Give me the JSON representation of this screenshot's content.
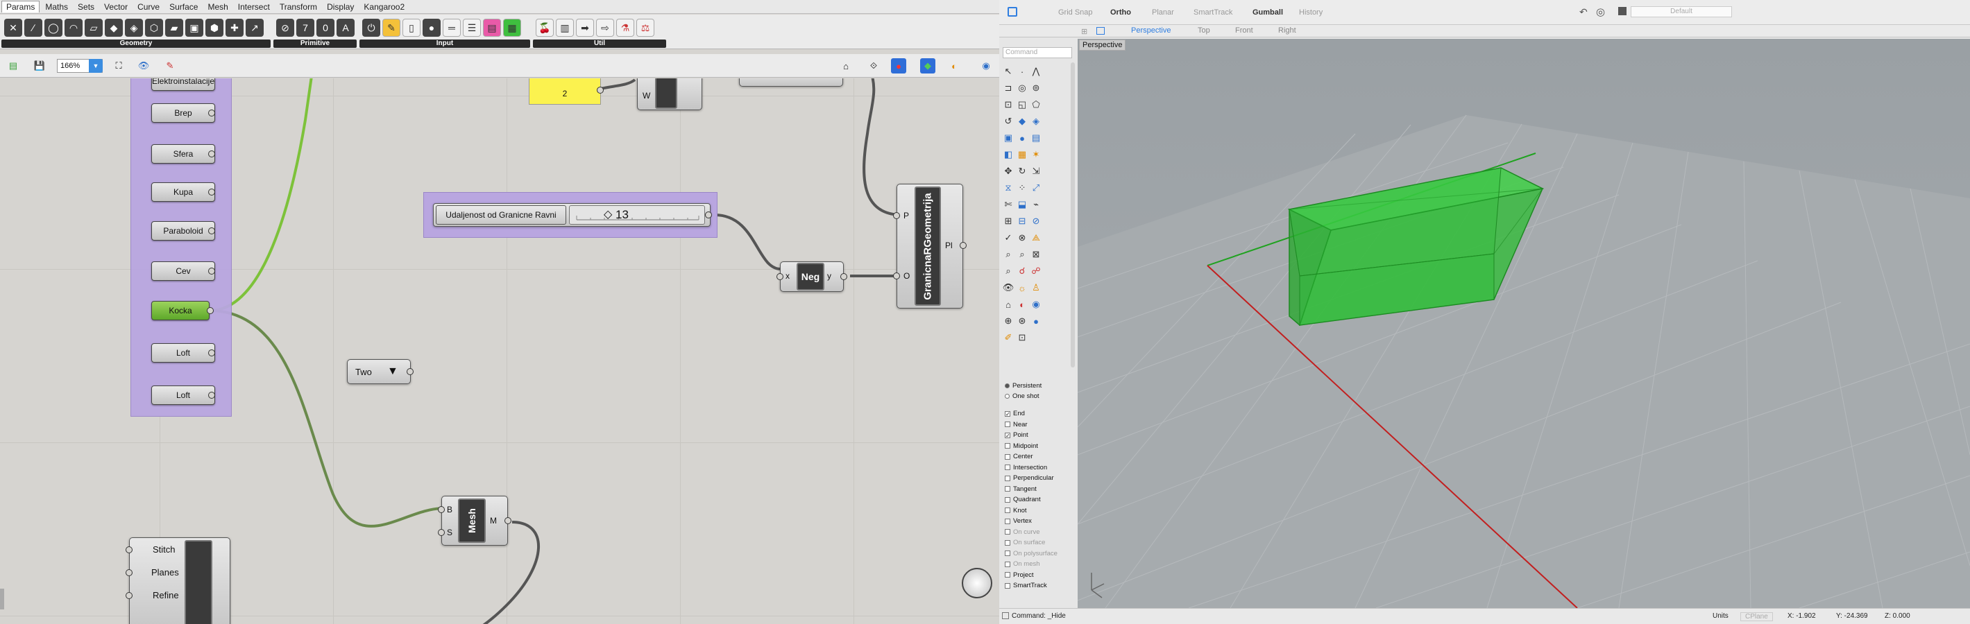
{
  "gh": {
    "tabs": [
      "Params",
      "Maths",
      "Sets",
      "Vector",
      "Curve",
      "Surface",
      "Mesh",
      "Intersect",
      "Transform",
      "Display",
      "Kangaroo2"
    ],
    "groups": [
      "Geometry",
      "Primitive",
      "Input",
      "Util"
    ],
    "zoom": "166%",
    "buttons": [
      "Brep",
      "Sfera",
      "Kupa",
      "Paraboloid",
      "Cev",
      "Kocka",
      "Loft",
      "Loft"
    ],
    "partial_button": "Elektroinstalacije",
    "panel_value": "2",
    "slider_label": "Udaljenost od Granicne Ravni",
    "slider_value": "13",
    "value_list": "Two",
    "neg": {
      "name": "Neg",
      "in": "x",
      "out": "y"
    },
    "granica": {
      "name": "GranicnaRGeometrija",
      "in1": "P",
      "in2": "O",
      "out": "Pl"
    },
    "mesh": {
      "name": "Mesh",
      "in1": "B",
      "in2": "S",
      "out": "M"
    },
    "w_comp_in": "W",
    "bottom_comp": {
      "inputs": [
        "Stitch",
        "Planes",
        "Refine"
      ]
    },
    "icon_colors": {
      "wire_green": "#7dc23a",
      "group": "#b9a6e0",
      "panel": "#fbf24f"
    }
  },
  "rhino": {
    "top": {
      "grid_snap": "Grid Snap",
      "ortho": "Ortho",
      "planar": "Planar",
      "smarttrack": "SmartTrack",
      "gumball": "Gumball",
      "history": "History",
      "layer": "Default"
    },
    "view_tabs": [
      "Perspective",
      "Top",
      "Front",
      "Right"
    ],
    "viewport_label": "Perspective",
    "command_placeholder": "Command",
    "osnap_mode": [
      {
        "label": "Persistent",
        "on": true
      },
      {
        "label": "One shot",
        "on": false
      }
    ],
    "osnaps": [
      {
        "label": "End",
        "checked": true,
        "enabled": true
      },
      {
        "label": "Near",
        "checked": false,
        "enabled": true
      },
      {
        "label": "Point",
        "checked": true,
        "enabled": true
      },
      {
        "label": "Midpoint",
        "checked": false,
        "enabled": true
      },
      {
        "label": "Center",
        "checked": false,
        "enabled": true
      },
      {
        "label": "Intersection",
        "checked": false,
        "enabled": true
      },
      {
        "label": "Perpendicular",
        "checked": false,
        "enabled": true
      },
      {
        "label": "Tangent",
        "checked": false,
        "enabled": true
      },
      {
        "label": "Quadrant",
        "checked": false,
        "enabled": true
      },
      {
        "label": "Knot",
        "checked": false,
        "enabled": true
      },
      {
        "label": "Vertex",
        "checked": false,
        "enabled": true
      },
      {
        "label": "On curve",
        "checked": false,
        "enabled": false
      },
      {
        "label": "On surface",
        "checked": false,
        "enabled": false
      },
      {
        "label": "On polysurface",
        "checked": false,
        "enabled": false
      },
      {
        "label": "On mesh",
        "checked": false,
        "enabled": false
      },
      {
        "label": "Project",
        "checked": false,
        "enabled": true
      },
      {
        "label": "SmartTrack",
        "checked": false,
        "enabled": true
      }
    ],
    "status": {
      "command": "Command: _Hide",
      "units": "Units",
      "cplane": "CPlane",
      "x": "X: -1.902",
      "y": "Y: -24.369",
      "z": "Z: 0.000"
    },
    "box_color": "#2fbf3a"
  }
}
